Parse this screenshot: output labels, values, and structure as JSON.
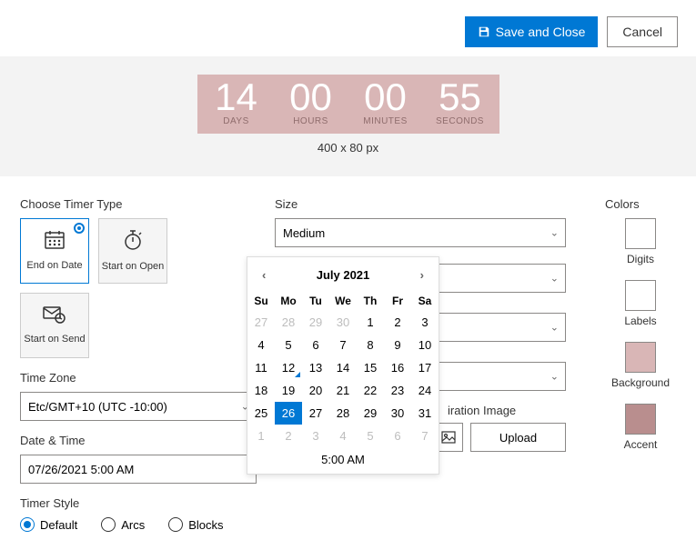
{
  "header": {
    "save_label": "Save and Close",
    "cancel_label": "Cancel"
  },
  "preview": {
    "days": "14",
    "days_label": "DAYS",
    "hours": "00",
    "hours_label": "HOURS",
    "minutes": "00",
    "minutes_label": "MINUTES",
    "seconds": "55",
    "seconds_label": "SECONDS",
    "dimensions": "400 x 80 px"
  },
  "left": {
    "choose_timer_label": "Choose Timer Type",
    "tiles": {
      "end_on_date": "End on Date",
      "start_on_open": "Start on Open",
      "start_on_send": "Start on Send"
    },
    "timezone_label": "Time Zone",
    "timezone_value": "Etc/GMT+10 (UTC -10:00)",
    "datetime_label": "Date & Time",
    "datetime_value": "07/26/2021 5:00 AM",
    "style_label": "Timer Style",
    "styles": {
      "default": "Default",
      "arcs": "Arcs",
      "blocks": "Blocks"
    }
  },
  "mid": {
    "size_label": "Size",
    "size_value": "Medium",
    "expiration_label": "iration Image",
    "upload_label": "Upload"
  },
  "right": {
    "colors_label": "Colors",
    "digits": {
      "label": "Digits",
      "color": "#ffffff"
    },
    "labels": {
      "label": "Labels",
      "color": "#ffffff"
    },
    "background": {
      "label": "Background",
      "color": "#d9b6b6"
    },
    "accent": {
      "label": "Accent",
      "color": "#b98e8e"
    }
  },
  "datepicker": {
    "title": "July 2021",
    "dow": [
      "Su",
      "Mo",
      "Tu",
      "We",
      "Th",
      "Fr",
      "Sa"
    ],
    "weeks": [
      [
        {
          "d": "27",
          "out": true
        },
        {
          "d": "28",
          "out": true
        },
        {
          "d": "29",
          "out": true
        },
        {
          "d": "30",
          "out": true
        },
        {
          "d": "1"
        },
        {
          "d": "2"
        },
        {
          "d": "3"
        }
      ],
      [
        {
          "d": "4"
        },
        {
          "d": "5"
        },
        {
          "d": "6"
        },
        {
          "d": "7"
        },
        {
          "d": "8"
        },
        {
          "d": "9"
        },
        {
          "d": "10"
        }
      ],
      [
        {
          "d": "11"
        },
        {
          "d": "12",
          "today": true
        },
        {
          "d": "13"
        },
        {
          "d": "14"
        },
        {
          "d": "15"
        },
        {
          "d": "16"
        },
        {
          "d": "17"
        }
      ],
      [
        {
          "d": "18"
        },
        {
          "d": "19"
        },
        {
          "d": "20"
        },
        {
          "d": "21"
        },
        {
          "d": "22"
        },
        {
          "d": "23"
        },
        {
          "d": "24"
        }
      ],
      [
        {
          "d": "25"
        },
        {
          "d": "26",
          "sel": true
        },
        {
          "d": "27"
        },
        {
          "d": "28"
        },
        {
          "d": "29"
        },
        {
          "d": "30"
        },
        {
          "d": "31"
        }
      ],
      [
        {
          "d": "1",
          "out": true
        },
        {
          "d": "2",
          "out": true
        },
        {
          "d": "3",
          "out": true
        },
        {
          "d": "4",
          "out": true
        },
        {
          "d": "5",
          "out": true
        },
        {
          "d": "6",
          "out": true
        },
        {
          "d": "7",
          "out": true
        }
      ]
    ],
    "time": "5:00 AM"
  }
}
